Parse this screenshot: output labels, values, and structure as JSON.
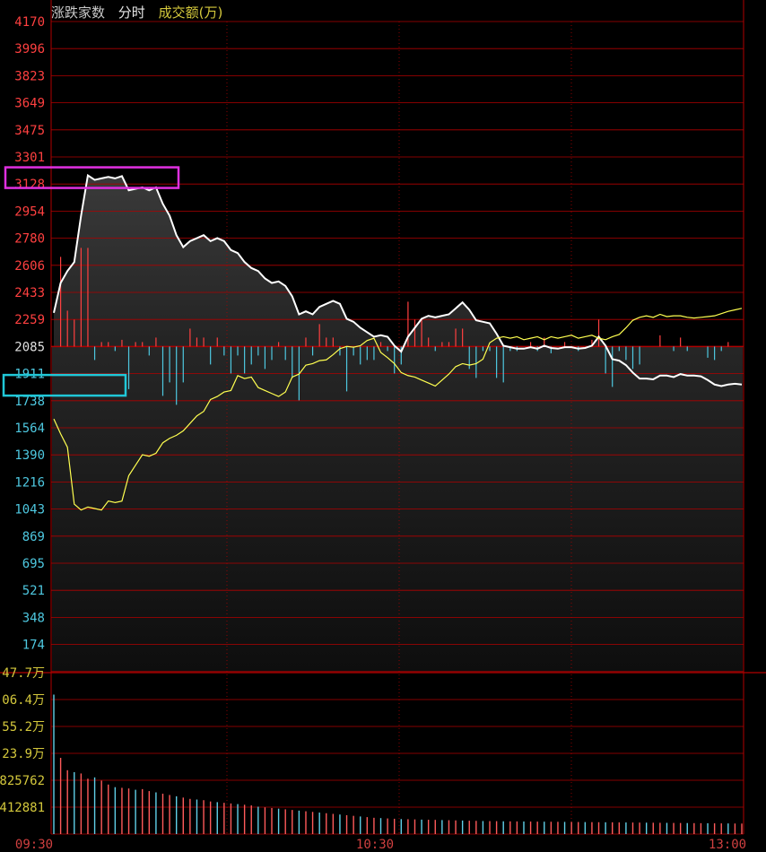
{
  "header": {
    "title": "涨跌家数",
    "period": "分时",
    "volume_label": "成交额(万)"
  },
  "colors": {
    "grid": "#b00000",
    "tick_up": "#ff4040",
    "tick_down": "#4ec8e0",
    "vol_label": "#d4c83c",
    "up_line": "#ffffff",
    "down_line": "#ffff50",
    "bar_up": "#ff5a5a",
    "bar_down": "#60d0e8",
    "highlight_up": "#e030e0",
    "highlight_down": "#20c8d8"
  },
  "chart_data": {
    "type": "line",
    "x_ticks": [
      "09:30",
      "10:30",
      "13:00"
    ],
    "y_ticks_up": [
      "4170",
      "3996",
      "3823",
      "3649",
      "3475",
      "3301",
      "3128",
      "2954",
      "2780",
      "2606",
      "2433",
      "2259"
    ],
    "y_center": "2085",
    "y_ticks_down": [
      "1911",
      "1738",
      "1564",
      "1390",
      "1216",
      "1043",
      "869",
      "695",
      "521",
      "348",
      "174"
    ],
    "ylim": [
      0,
      4170
    ],
    "volume_ticks": [
      "47.7万",
      "06.4万",
      "55.2万",
      "23.9万",
      "825762",
      "412881"
    ],
    "volume_ylim": [
      0,
      2478000
    ],
    "highlights": [
      {
        "value": "3128",
        "side": "up"
      },
      {
        "value": "1738",
        "side": "down"
      }
    ],
    "series": [
      {
        "kind": "up",
        "x": [
          0,
          2,
          4,
          6,
          8,
          10,
          12,
          14,
          16,
          18,
          20,
          22,
          24,
          26,
          28,
          30,
          32,
          34,
          36,
          38,
          40,
          42,
          44,
          46,
          48,
          50,
          52,
          54,
          56,
          58,
          60,
          62,
          64,
          66,
          68,
          70,
          72,
          74,
          76,
          78,
          80,
          82,
          84,
          86,
          88,
          90,
          92,
          94,
          96,
          98,
          100,
          102,
          104,
          106,
          108,
          110,
          112,
          114,
          116,
          118,
          120,
          122,
          124,
          126,
          128,
          130,
          132,
          134,
          136,
          138,
          140,
          142,
          144,
          146,
          148,
          150,
          152,
          154,
          156,
          158,
          160,
          162,
          164,
          166,
          168,
          170,
          172,
          174,
          176,
          178,
          180,
          182,
          184,
          186,
          188,
          190,
          192,
          194,
          196,
          198,
          200,
          202
        ],
        "values": [
          2220,
          2420,
          2500,
          2560,
          2870,
          3140,
          3110,
          3120,
          3130,
          3120,
          3135,
          3040,
          3050,
          3060,
          3040,
          3060,
          2950,
          2870,
          2740,
          2660,
          2700,
          2720,
          2740,
          2700,
          2720,
          2700,
          2640,
          2620,
          2560,
          2520,
          2500,
          2450,
          2420,
          2430,
          2400,
          2330,
          2210,
          2230,
          2210,
          2260,
          2280,
          2300,
          2280,
          2180,
          2160,
          2120,
          2090,
          2060,
          2070,
          2060,
          2000,
          1960,
          2060,
          2120,
          2180,
          2200,
          2190,
          2200,
          2210,
          2250,
          2290,
          2240,
          2170,
          2160,
          2150,
          2080,
          2000,
          1990,
          1980,
          1980,
          1990,
          1980,
          2000,
          1985,
          1980,
          1990,
          1990,
          1980,
          1985,
          2000,
          2060,
          2000,
          1910,
          1900,
          1870,
          1820,
          1780,
          1780,
          1775,
          1800,
          1800,
          1790,
          1810,
          1800,
          1800,
          1795,
          1770,
          1740,
          1730,
          1740,
          1745,
          1740
        ]
      },
      {
        "kind": "down",
        "x": [
          0,
          2,
          4,
          6,
          8,
          10,
          12,
          14,
          16,
          18,
          20,
          22,
          24,
          26,
          28,
          30,
          32,
          34,
          36,
          38,
          40,
          42,
          44,
          46,
          48,
          50,
          52,
          54,
          56,
          58,
          60,
          62,
          64,
          66,
          68,
          70,
          72,
          74,
          76,
          78,
          80,
          82,
          84,
          86,
          88,
          90,
          92,
          94,
          96,
          98,
          100,
          102,
          104,
          106,
          108,
          110,
          112,
          114,
          116,
          118,
          120,
          122,
          124,
          126,
          128,
          130,
          132,
          134,
          136,
          138,
          140,
          142,
          144,
          146,
          148,
          150,
          152,
          154,
          156,
          158,
          160,
          162,
          164,
          166,
          168,
          170,
          172,
          174,
          176,
          178,
          180,
          182,
          184,
          186,
          188,
          190,
          192,
          194,
          196,
          198,
          200,
          202
        ],
        "values": [
          1510,
          1410,
          1320,
          940,
          900,
          920,
          910,
          900,
          960,
          950,
          960,
          1130,
          1200,
          1270,
          1260,
          1280,
          1350,
          1380,
          1400,
          1430,
          1480,
          1530,
          1560,
          1640,
          1660,
          1690,
          1700,
          1800,
          1780,
          1790,
          1720,
          1700,
          1680,
          1660,
          1690,
          1790,
          1810,
          1870,
          1880,
          1900,
          1905,
          1940,
          1980,
          1995,
          1990,
          2000,
          2035,
          2050,
          1955,
          1920,
          1880,
          1820,
          1800,
          1790,
          1770,
          1750,
          1730,
          1770,
          1810,
          1860,
          1880,
          1870,
          1880,
          1910,
          2020,
          2050,
          2060,
          2050,
          2060,
          2040,
          2050,
          2060,
          2040,
          2060,
          2050,
          2060,
          2070,
          2050,
          2060,
          2070,
          2050,
          2040,
          2060,
          2075,
          2120,
          2170,
          2190,
          2200,
          2190,
          2210,
          2195,
          2200,
          2200,
          2190,
          2185,
          2190,
          2195,
          2200,
          2215,
          2230,
          2240,
          2250
        ]
      }
    ],
    "volume_bars": [
      2140000,
      1170000,
      980000,
      950000,
      930000,
      850000,
      870000,
      820000,
      760000,
      720000,
      710000,
      700000,
      680000,
      690000,
      660000,
      640000,
      620000,
      600000,
      580000,
      560000,
      540000,
      530000,
      520000,
      500000,
      490000,
      480000,
      470000,
      460000,
      450000,
      440000,
      420000,
      410000,
      400000,
      390000,
      380000,
      370000,
      360000,
      350000,
      340000,
      330000,
      320000,
      310000,
      300000,
      290000,
      280000,
      270000,
      260000,
      250000,
      245000,
      240000,
      235000,
      230000,
      228000,
      225000,
      222000,
      220000,
      218000,
      215000,
      213000,
      210000,
      208000,
      205000,
      203000,
      200000,
      199000,
      198000,
      196000,
      195000,
      194000,
      193000,
      192000,
      191000,
      190000,
      189000,
      188000,
      187000,
      186000,
      185000,
      184000,
      183000,
      182000,
      181000,
      180000,
      179000,
      178000,
      177000,
      176000,
      175000,
      174000,
      173000,
      172000,
      171000,
      170000,
      169000,
      168000,
      167000,
      166000,
      165000,
      164000,
      163000,
      162000,
      161000
    ]
  }
}
